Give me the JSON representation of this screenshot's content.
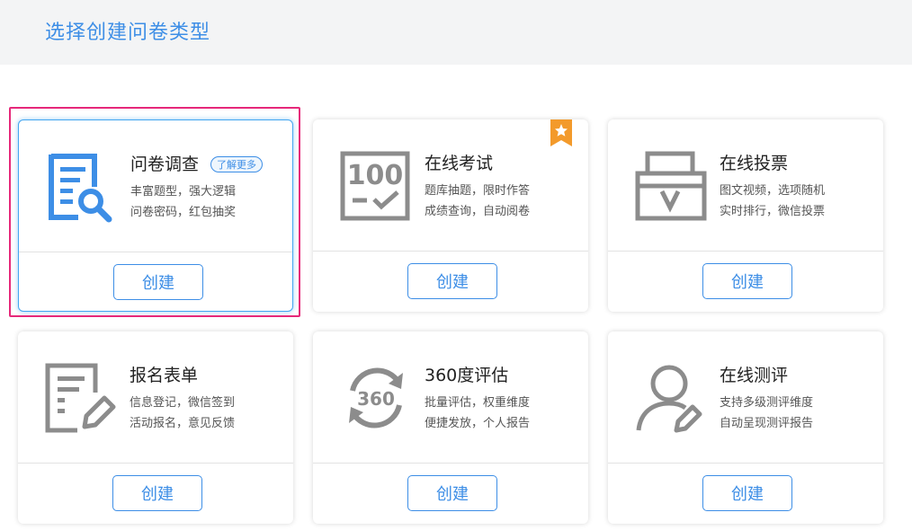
{
  "header": {
    "title": "选择创建问卷类型"
  },
  "colors": {
    "accent": "#3d8ee6",
    "icon_gray": "#8c8c8c",
    "highlight": "#e6287a",
    "badge": "#f39a2b"
  },
  "cards": [
    {
      "title": "问卷调查",
      "desc1": "丰富题型，强大逻辑",
      "desc2": "问卷密码，红包抽奖",
      "button": "创建",
      "tag": "了解更多",
      "icon": "survey-magnifier-icon"
    },
    {
      "title": "在线考试",
      "desc1": "题库抽题，限时作答",
      "desc2": "成绩查询，自动阅卷",
      "button": "创建",
      "icon": "exam-100-icon",
      "badge_icon": "star-ribbon-icon"
    },
    {
      "title": "在线投票",
      "desc1": "图文视频，选项随机",
      "desc2": "实时排行，微信投票",
      "button": "创建",
      "icon": "ballot-box-icon"
    },
    {
      "title": "报名表单",
      "desc1": "信息登记，微信签到",
      "desc2": "活动报名，意见反馈",
      "button": "创建",
      "icon": "form-pencil-icon"
    },
    {
      "title": "360度评估",
      "desc1": "批量评估，权重维度",
      "desc2": "便捷发放，个人报告",
      "button": "创建",
      "icon": "360-cycle-icon",
      "icon_text": "360"
    },
    {
      "title": "在线测评",
      "desc1": "支持多级测评维度",
      "desc2": "自动呈现测评报告",
      "button": "创建",
      "icon": "user-edit-icon"
    }
  ]
}
